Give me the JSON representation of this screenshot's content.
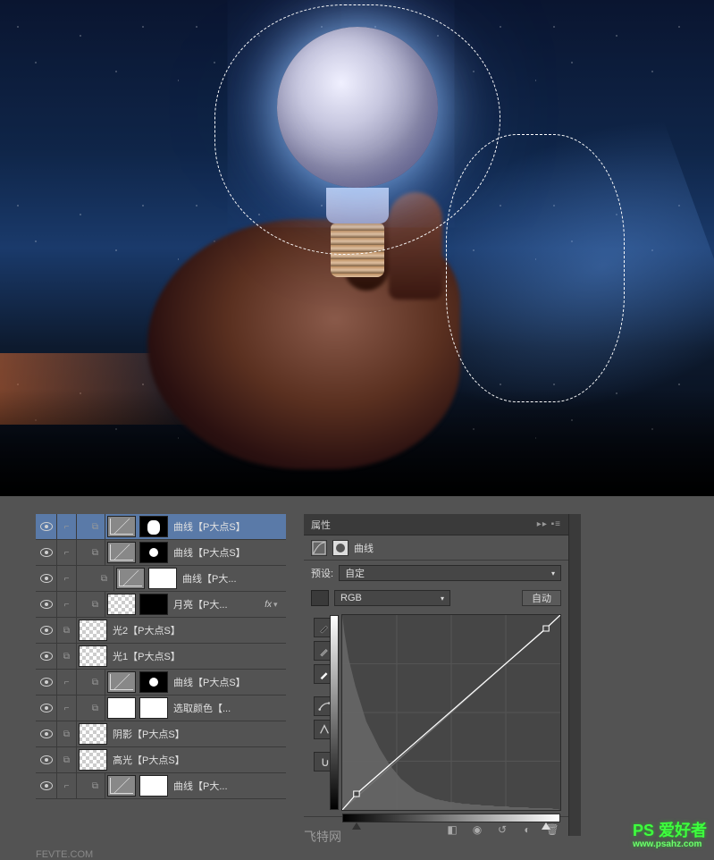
{
  "layers": [
    {
      "id": "l1",
      "selected": true,
      "indent": 1,
      "vis": true,
      "thumbs": [
        "curves",
        "dark-hand"
      ],
      "name": "曲线【P大点S】",
      "fx": false
    },
    {
      "id": "l2",
      "selected": false,
      "indent": 1,
      "vis": true,
      "thumbs": [
        "curves",
        "dark-spot"
      ],
      "name": "曲线【P大点S】",
      "fx": false
    },
    {
      "id": "l3",
      "selected": false,
      "indent": 2,
      "vis": true,
      "thumbs": [
        "curves",
        "mask"
      ],
      "name": "曲线【P大...",
      "fx": false
    },
    {
      "id": "l4",
      "selected": false,
      "indent": 1,
      "vis": true,
      "thumbs": [
        "trans",
        "dark"
      ],
      "name": "月亮【P大...",
      "fx": true
    },
    {
      "id": "l5",
      "selected": false,
      "indent": 0,
      "vis": true,
      "thumbs": [
        "trans"
      ],
      "name": "光2【P大点S】",
      "fx": false
    },
    {
      "id": "l6",
      "selected": false,
      "indent": 0,
      "vis": true,
      "thumbs": [
        "trans"
      ],
      "name": "光1【P大点S】",
      "fx": false
    },
    {
      "id": "l7",
      "selected": false,
      "indent": 1,
      "vis": true,
      "thumbs": [
        "curves",
        "dark-spot"
      ],
      "name": "曲线【P大点S】",
      "fx": false
    },
    {
      "id": "l8",
      "selected": false,
      "indent": 1,
      "vis": true,
      "thumbs": [
        "mask",
        "mask"
      ],
      "name": "选取颜色【...",
      "fx": false
    },
    {
      "id": "l9",
      "selected": false,
      "indent": 0,
      "vis": true,
      "thumbs": [
        "trans"
      ],
      "name": "阴影【P大点S】",
      "fx": false
    },
    {
      "id": "l10",
      "selected": false,
      "indent": 0,
      "vis": true,
      "thumbs": [
        "trans"
      ],
      "name": "高光【P大点S】",
      "fx": false
    },
    {
      "id": "l11",
      "selected": false,
      "indent": 1,
      "vis": true,
      "thumbs": [
        "curves",
        "mask"
      ],
      "name": "曲线【P大...",
      "fx": false
    }
  ],
  "props": {
    "panelTitle": "属性",
    "adjustmentName": "曲线",
    "presetLabel": "预设:",
    "presetValue": "自定",
    "channelValue": "RGB",
    "autoLabel": "自动"
  },
  "watermarks": {
    "center": "飞特网",
    "rightMain": "PS 爱好者",
    "rightSub": "www.psahz.com",
    "bottomLeft": "FEVTE.COM"
  },
  "histogram": [
    220,
    200,
    185,
    170,
    160,
    150,
    140,
    132,
    124,
    116,
    108,
    100,
    95,
    90,
    85,
    80,
    75,
    70,
    66,
    62,
    58,
    54,
    50,
    47,
    44,
    41,
    38,
    35,
    33,
    31,
    29,
    27,
    25,
    23,
    21,
    20,
    19,
    18,
    17,
    16,
    15,
    14,
    13,
    12,
    12,
    11,
    11,
    10,
    10,
    9,
    9,
    9,
    8,
    8,
    8,
    7,
    7,
    7,
    7,
    6,
    6,
    6,
    6,
    6,
    5,
    5,
    5,
    5,
    5,
    5,
    4,
    4,
    4,
    4,
    4,
    4,
    4,
    3,
    3,
    3,
    3,
    3,
    3,
    3,
    3,
    3,
    2,
    2,
    2,
    2,
    2,
    2,
    2,
    2,
    2,
    2,
    2,
    1,
    1,
    1
  ],
  "curve": {
    "p1": [
      15,
      200
    ],
    "p2": [
      215,
      15
    ]
  }
}
